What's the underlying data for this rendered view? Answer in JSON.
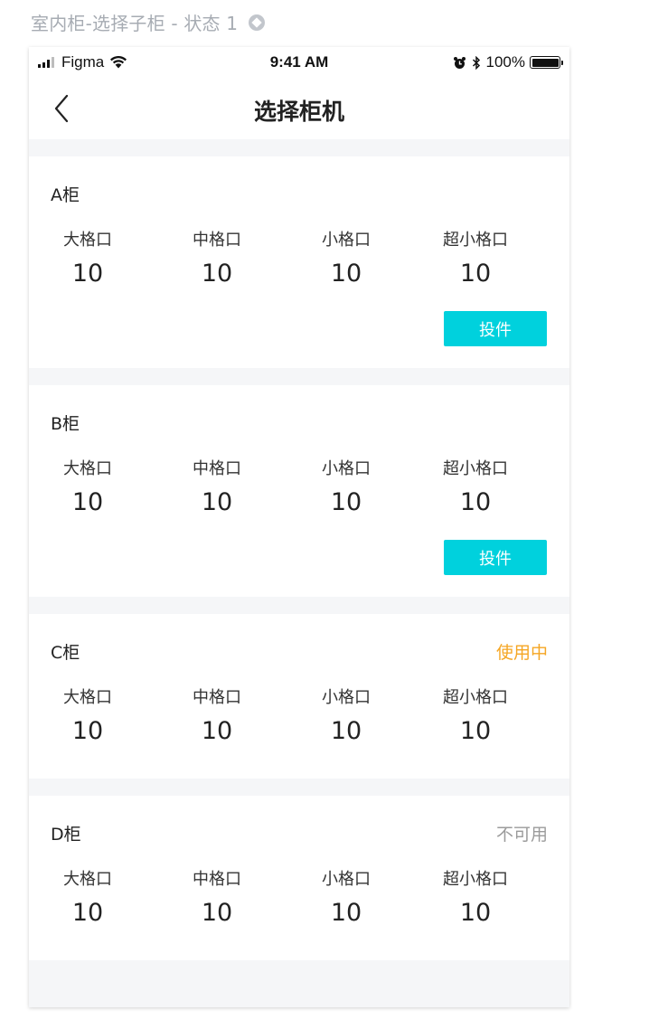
{
  "frame": {
    "title": "室内柜-选择子柜 - 状态 1"
  },
  "status_bar": {
    "carrier": "Figma",
    "time": "9:41 AM",
    "battery": "100%"
  },
  "nav": {
    "title": "选择柜机"
  },
  "cabinets": [
    {
      "name": "A柜",
      "status": "",
      "compartments": [
        {
          "label": "大格口",
          "count": "10"
        },
        {
          "label": "中格口",
          "count": "10"
        },
        {
          "label": "小格口",
          "count": "10"
        },
        {
          "label": "超小格口",
          "count": "10"
        }
      ],
      "action_label": "投件"
    },
    {
      "name": "B柜",
      "status": "",
      "compartments": [
        {
          "label": "大格口",
          "count": "10"
        },
        {
          "label": "中格口",
          "count": "10"
        },
        {
          "label": "小格口",
          "count": "10"
        },
        {
          "label": "超小格口",
          "count": "10"
        }
      ],
      "action_label": "投件"
    },
    {
      "name": "C柜",
      "status": "使用中",
      "status_color": "#f5a623",
      "compartments": [
        {
          "label": "大格口",
          "count": "10"
        },
        {
          "label": "中格口",
          "count": "10"
        },
        {
          "label": "小格口",
          "count": "10"
        },
        {
          "label": "超小格口",
          "count": "10"
        }
      ]
    },
    {
      "name": "D柜",
      "status": "不可用",
      "status_color": "#9b9b9b",
      "compartments": [
        {
          "label": "大格口",
          "count": "10"
        },
        {
          "label": "中格口",
          "count": "10"
        },
        {
          "label": "小格口",
          "count": "10"
        },
        {
          "label": "超小格口",
          "count": "10"
        }
      ]
    }
  ],
  "colors": {
    "accent": "#00d1dd",
    "in_use": "#f5a623",
    "unavailable": "#9b9b9b",
    "background": "#f5f6f8"
  }
}
